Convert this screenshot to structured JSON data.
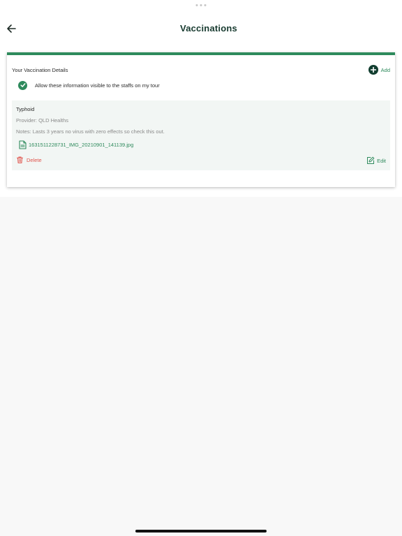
{
  "header": {
    "title": "Vaccinations",
    "back_icon": "arrow-left-icon"
  },
  "details": {
    "title": "Your Vaccination Details",
    "add_label": "Add",
    "add_icon": "plus-circle-icon",
    "consent_text": "Allow these information visible to the staffs on my tour",
    "consent_checked": true
  },
  "records": [
    {
      "name": "Typhoid",
      "provider": "Provider: QLD Healths",
      "notes": "Notes: Lasts 3 years no virus with zero effects so check this out.",
      "attachment": "1631511228731_IMG_20210901_141139.jpg",
      "delete_label": "Delete",
      "edit_label": "Edit"
    }
  ],
  "colors": {
    "accent": "#2e8a5c",
    "dark_green": "#123e30",
    "danger": "#e0534b",
    "record_bg": "#f2f6f4"
  }
}
